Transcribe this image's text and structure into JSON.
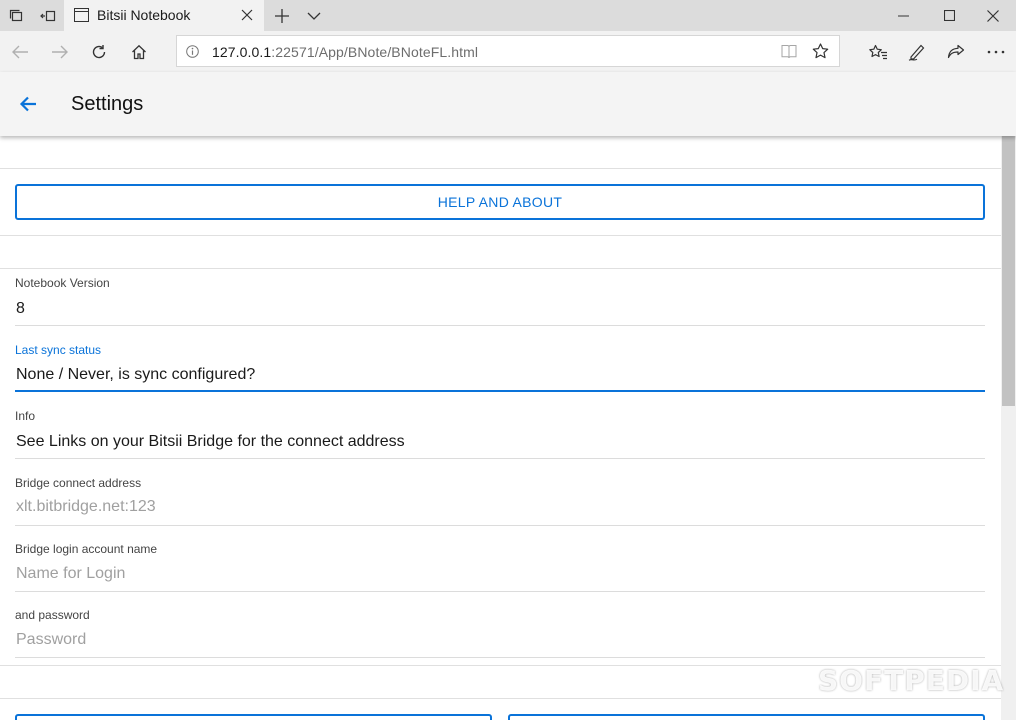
{
  "browser": {
    "tab_title": "Bitsii Notebook",
    "url_host": "127.0.0.1",
    "url_rest": ":22571/App/BNote/BNoteFL.html"
  },
  "header": {
    "title": "Settings"
  },
  "help_button": {
    "label": "HELP AND ABOUT"
  },
  "fields": {
    "notebook_version": {
      "label": "Notebook Version",
      "value": "8"
    },
    "last_sync_status": {
      "label": "Last sync status",
      "value": "None / Never, is sync configured?"
    },
    "info": {
      "label": "Info",
      "value": "See Links on your Bitsii Bridge for the connect address"
    },
    "bridge_address": {
      "label": "Bridge connect address",
      "placeholder": "xlt.bitbridge.net:123"
    },
    "bridge_account": {
      "label": "Bridge login account name",
      "placeholder": "Name for Login"
    },
    "password": {
      "label": "and password",
      "placeholder": "Password"
    }
  },
  "watermark": "SOFTPEDIA",
  "colors": {
    "accent": "#0a73d9",
    "header_bg": "#f4f4f4",
    "chrome_bg": "#dcdcdc"
  }
}
